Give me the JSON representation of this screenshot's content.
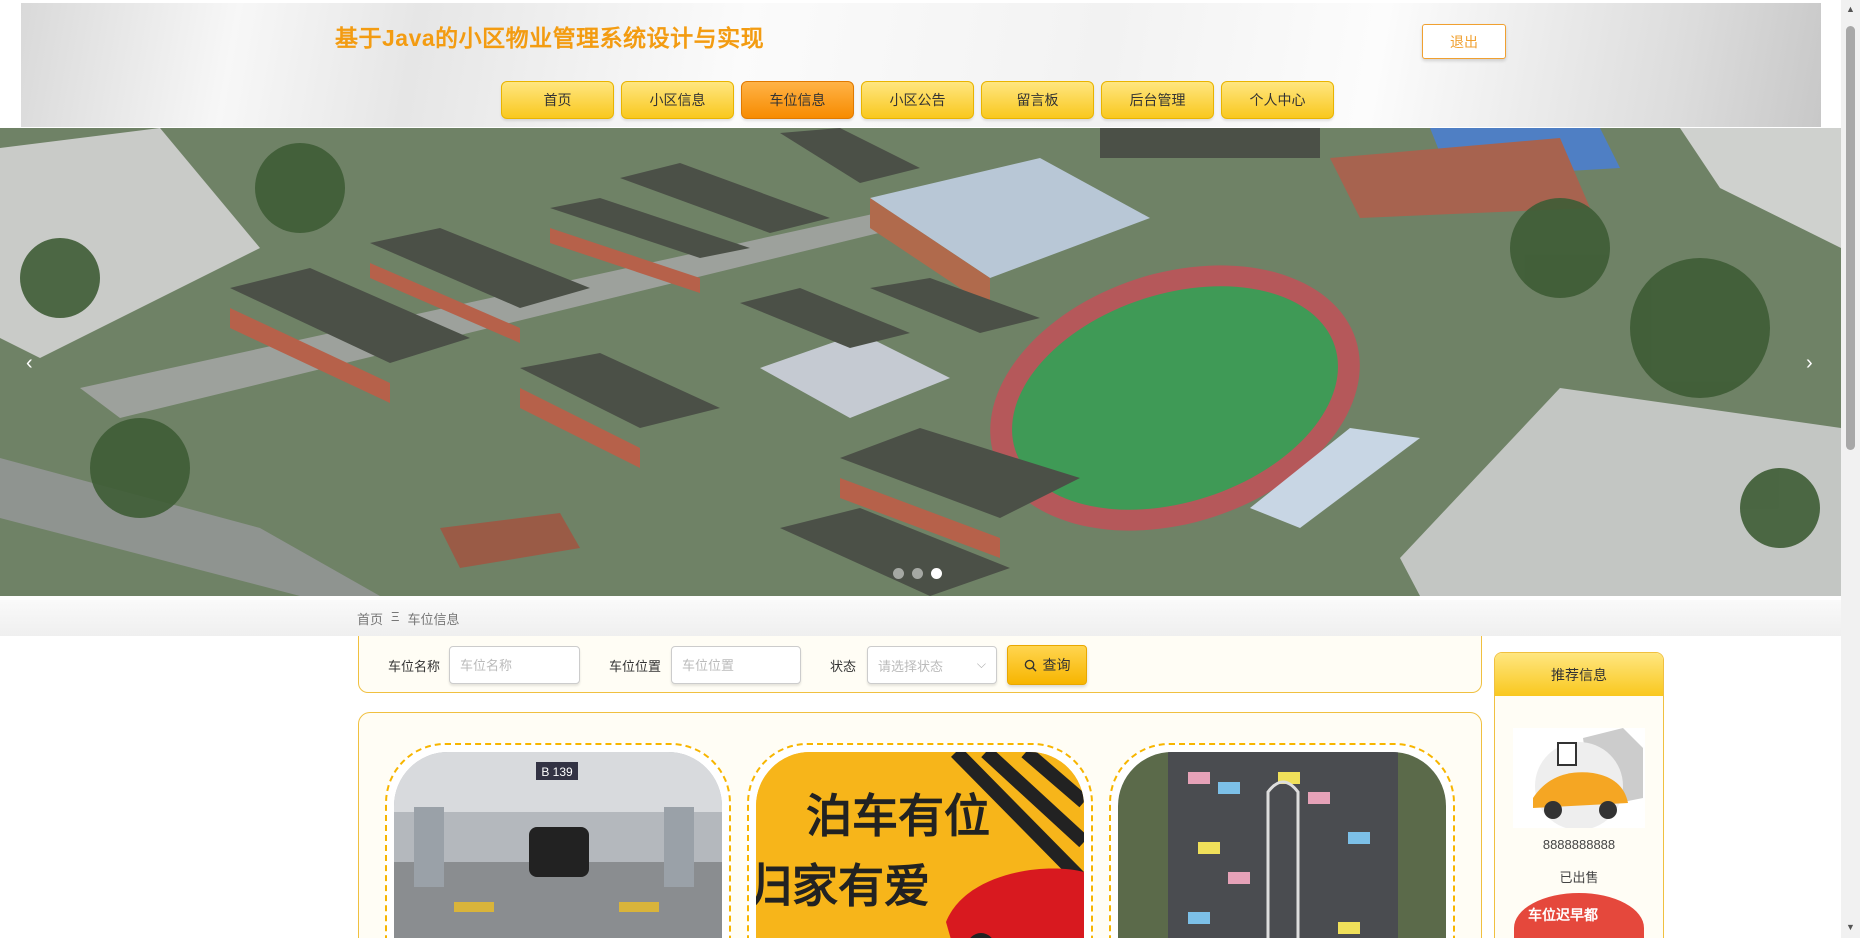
{
  "site": {
    "title": "基于Java的小区物业管理系统设计与实现",
    "logout_label": "退出"
  },
  "nav": {
    "items": [
      {
        "label": "首页"
      },
      {
        "label": "小区信息"
      },
      {
        "label": "车位信息"
      },
      {
        "label": "小区公告"
      },
      {
        "label": "留言板"
      },
      {
        "label": "后台管理"
      },
      {
        "label": "个人中心"
      }
    ],
    "active": "车位信息"
  },
  "banner": {
    "prev_glyph": "‹",
    "next_glyph": "›",
    "slide_count": 3,
    "active_slide": 3
  },
  "breadcrumb": {
    "home": "首页",
    "separator": "Ξ",
    "current": "车位信息"
  },
  "search": {
    "name_label": "车位名称",
    "name_placeholder": "车位名称",
    "location_label": "车位位置",
    "location_placeholder": "车位位置",
    "status_label": "状态",
    "status_placeholder": "请选择状态",
    "button_label": "查询",
    "button_icon": "search-icon"
  },
  "cards": [
    {
      "image": "underground-parking-photo",
      "sign_text": "B 139"
    },
    {
      "image": "parking-poster",
      "poster_line1": "泊车有位",
      "poster_line2": "归家有爱"
    },
    {
      "image": "aerial-parking-lot-photo"
    }
  ],
  "sidebar": {
    "title": "推荐信息",
    "item_value": "8888888888",
    "item_status": "已出售",
    "next_item_banner": "车位迟早都"
  },
  "colors": {
    "accent": "#f39c12",
    "nav_bg": "#f9c81e",
    "nav_active": "#f78b00",
    "border": "#f0c040"
  }
}
